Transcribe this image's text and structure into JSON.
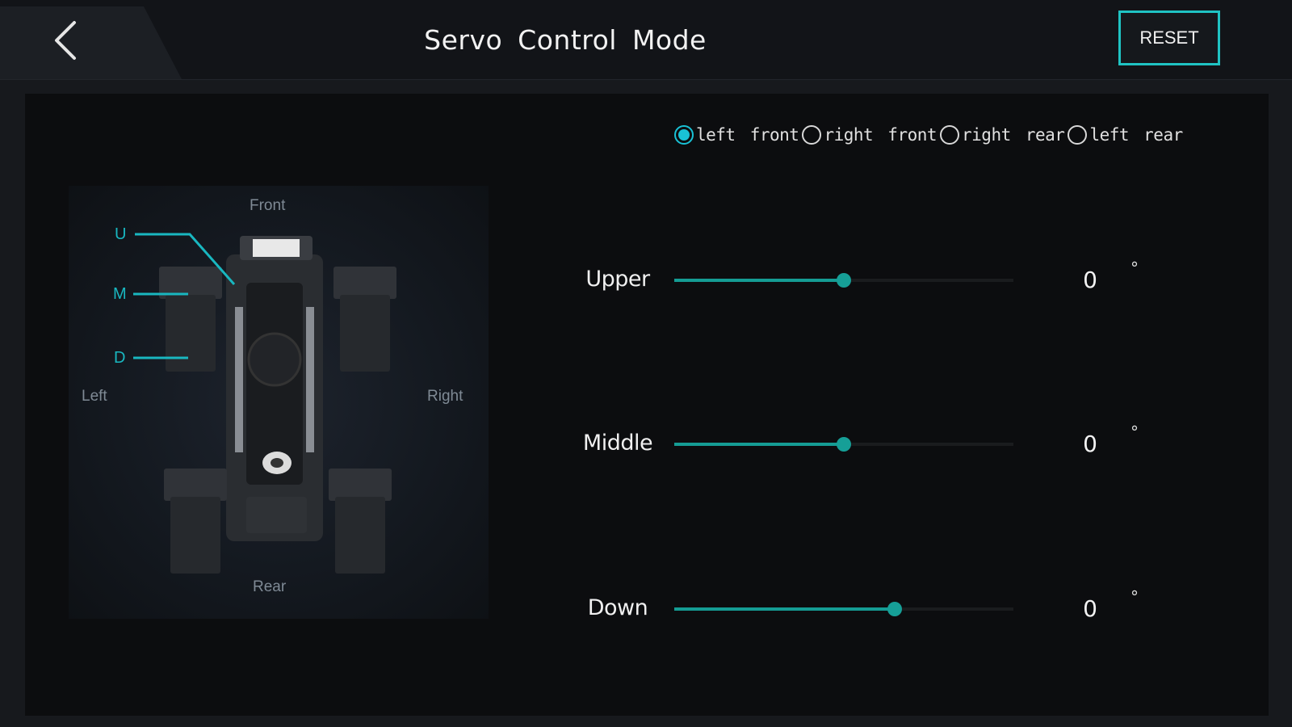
{
  "header": {
    "title": "Servo Control Mode",
    "reset_label": "RESET"
  },
  "diagram": {
    "front": "Front",
    "rear": "Rear",
    "left": "Left",
    "right": "Right",
    "joints": {
      "upper": "U",
      "middle": "M",
      "down": "D"
    }
  },
  "legs": {
    "options": [
      {
        "label": "left front",
        "checked": true
      },
      {
        "label": "right front",
        "checked": false
      },
      {
        "label": "right rear",
        "checked": false
      },
      {
        "label": "left rear",
        "checked": false
      }
    ]
  },
  "servos": [
    {
      "label": "Upper",
      "value": "0",
      "unit": "°",
      "slider_fraction": 0.5
    },
    {
      "label": "Middle",
      "value": "0",
      "unit": "°",
      "slider_fraction": 0.5
    },
    {
      "label": "Down",
      "value": "0",
      "unit": "°",
      "slider_fraction": 0.65
    }
  ],
  "colors": {
    "accent": "#19c2d6",
    "slider": "#159c94",
    "reset_border": "#1fc3c3"
  }
}
